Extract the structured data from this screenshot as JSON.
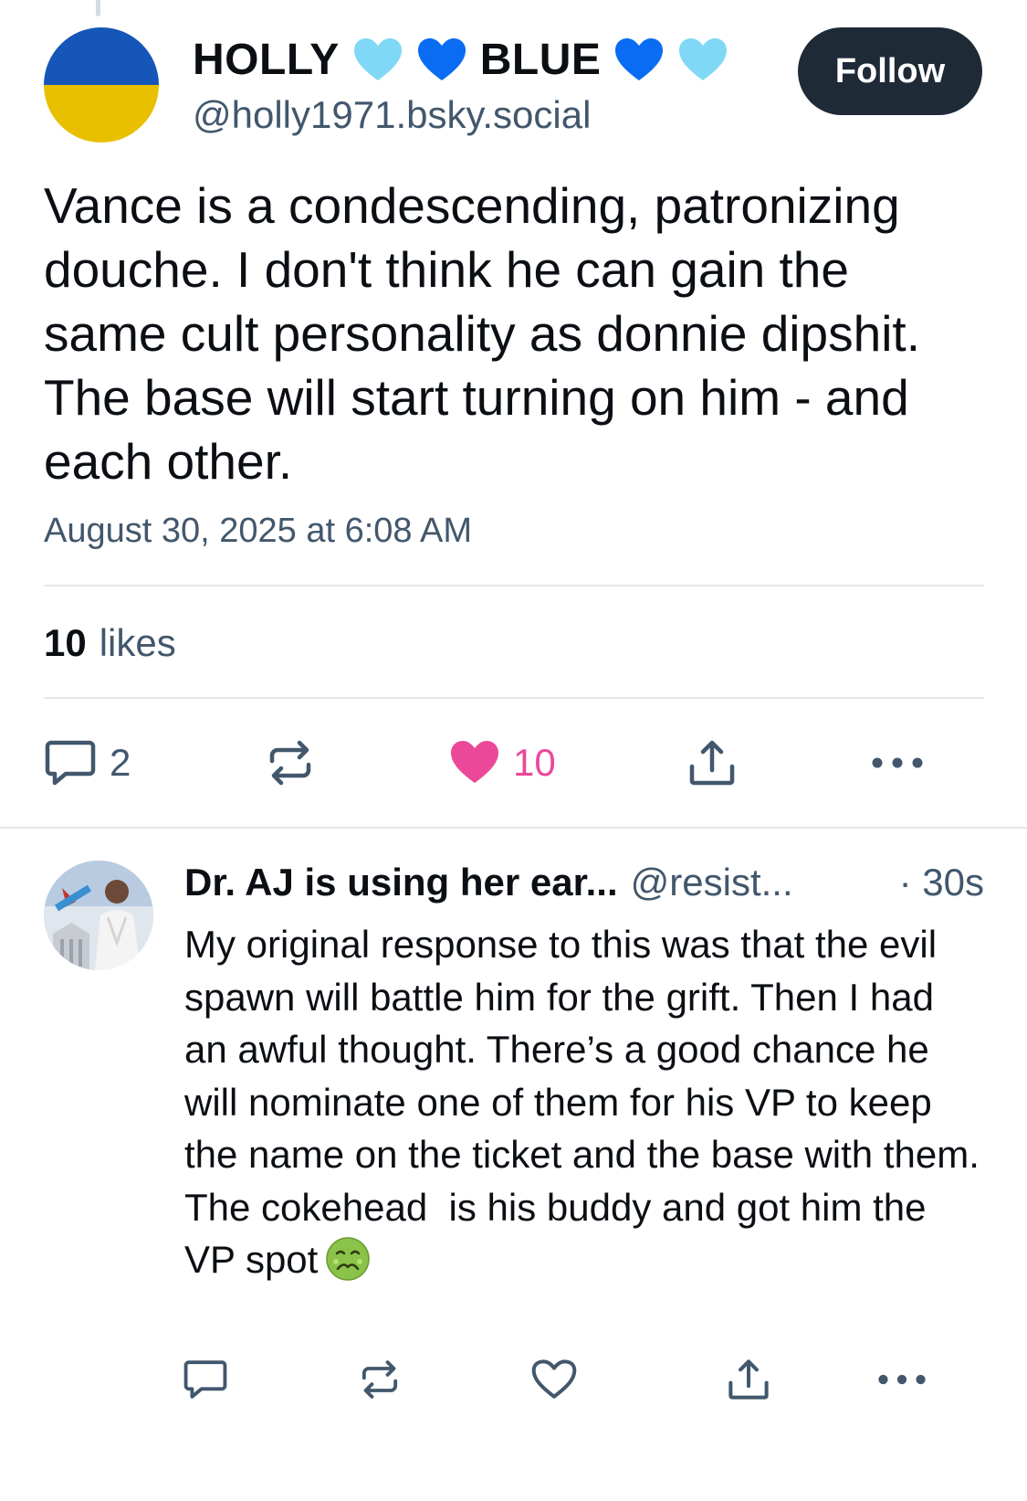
{
  "post": {
    "author_name_first": "HOLLY",
    "author_name_second": "BLUE",
    "author_handle": "@holly1971.bsky.social",
    "follow_label": "Follow",
    "text": "Vance is a condescending, patronizing douche. I don't think he can gain the same cult personality as donnie dipshit. The base will start turning on him - and each other.",
    "date": "August 30, 2025 at 6:08 AM",
    "likes_count": "10",
    "likes_label": "likes",
    "reply_count": "2",
    "like_count": "10",
    "name_hearts": [
      "light-blue-heart",
      "blue-heart",
      "blue-heart",
      "light-blue-heart"
    ],
    "avatar_colors": {
      "top": "#1556b8",
      "bottom": "#e8c000"
    }
  },
  "reply": {
    "author_name": "Dr. AJ is using her ear...",
    "author_handle": "@resist...",
    "time": "· 30s",
    "text": "My original response to this was that the evil spawn will battle him for the grift. Then I had an awful thought. There’s a good chance he will nominate one of them for his VP to keep the name on the ticket and the base with them. The cokehead  is his buddy and got him the VP spot",
    "emoji": "nauseated-face"
  },
  "colors": {
    "accent_like": "#ec4899",
    "muted": "#42576c",
    "follow_bg": "#1f2a37",
    "heart_light_blue": "#7fd8f5",
    "heart_blue": "#0a6cf2"
  }
}
